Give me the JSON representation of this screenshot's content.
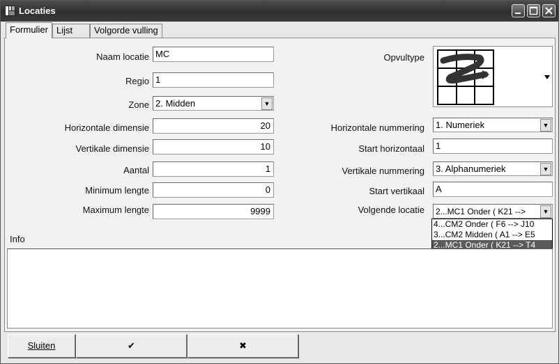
{
  "window": {
    "title": "Locaties"
  },
  "tabs": [
    {
      "label": "Formulier",
      "active": true
    },
    {
      "label": "Lijst",
      "active": false
    },
    {
      "label": "Volgorde vulling",
      "active": false
    }
  ],
  "form": {
    "naam_locatie": {
      "label": "Naam locatie",
      "value": "MC"
    },
    "regio": {
      "label": "Regio",
      "value": "1"
    },
    "zone": {
      "label": "Zone",
      "value": "2.  Midden"
    },
    "hor_dim": {
      "label": "Horizontale dimensie",
      "value": "20"
    },
    "vert_dim": {
      "label": "Vertikale dimensie",
      "value": "10"
    },
    "aantal": {
      "label": "Aantal",
      "value": "1"
    },
    "min_lengte": {
      "label": "Minimum lengte",
      "value": "0"
    },
    "max_lengte": {
      "label": "Maximum lengte",
      "value": "9999"
    },
    "opvultype": {
      "label": "Opvultype"
    },
    "hor_nummering": {
      "label": "Horizontale nummering",
      "value": "1.  Numeriek"
    },
    "start_hor": {
      "label": "Start horizontaal",
      "value": "1"
    },
    "vert_nummering": {
      "label": "Vertikale nummering",
      "value": "3.  Alphanumeriek"
    },
    "start_vert": {
      "label": "Start vertikaal",
      "value": "A"
    },
    "volgende_locatie": {
      "label": "Volgende locatie",
      "value": "2...MC1  Onder (   K21 -->",
      "options": [
        "4...CM2  Onder (    F6 -->    J10",
        "3...CM2  Midden (    A1 -->     E5",
        "2...MC1  Onder (   K21 -->     T4"
      ],
      "selected_index": 2
    },
    "info_label": "Info"
  },
  "buttons": {
    "sluiten": "Sluiten",
    "ok": "✔",
    "cancel": "✖"
  }
}
